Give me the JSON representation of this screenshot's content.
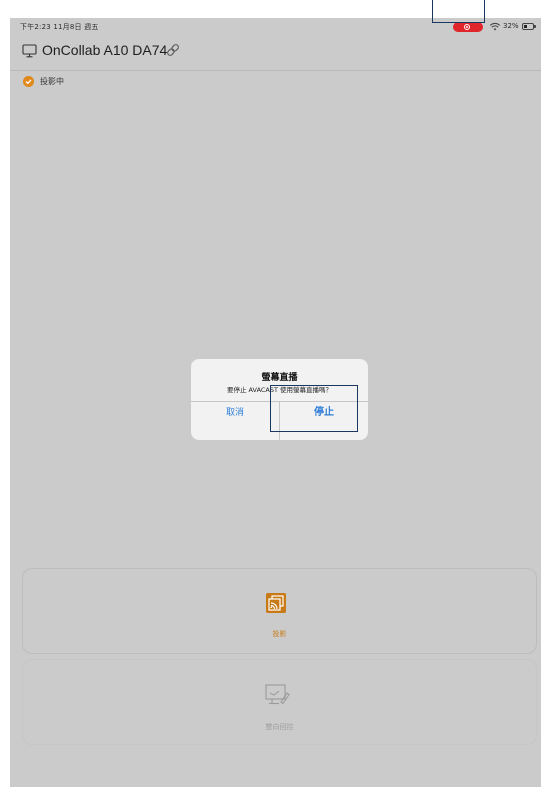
{
  "status_bar": {
    "time": "下午2:23  11月8日 週五",
    "battery_percent": "32%",
    "recording_active": true,
    "recording_color": "#e0262a"
  },
  "header": {
    "device_name": "OnCollab A10 DA74",
    "icons": [
      "monitor-icon",
      "link-icon"
    ]
  },
  "casting_status": {
    "label": "投影中",
    "icon": "check-circle-icon",
    "color": "#e08a1e"
  },
  "dialog": {
    "title": "螢幕直播",
    "message": "要停止 AVACAST 使用螢幕直播嗎？",
    "cancel_label": "取消",
    "stop_label": "停止",
    "button_color": "#2f7ed9"
  },
  "actions": {
    "cast": {
      "label": "投影",
      "icon": "cast-icon",
      "color": "#c87a16"
    },
    "remote": {
      "label": "雙向回控",
      "icon": "remote-control-icon",
      "enabled": false
    }
  }
}
